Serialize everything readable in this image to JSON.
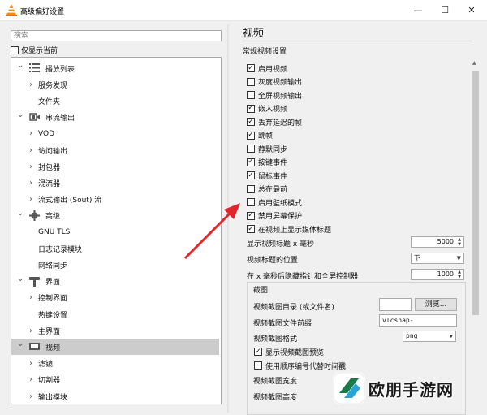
{
  "window": {
    "title": "高级偏好设置",
    "controls": {
      "minimize": "—",
      "maximize": "☐",
      "close": "✕"
    }
  },
  "left": {
    "search_placeholder": "搜索",
    "only_current_label": "仅显示当前",
    "tree": [
      {
        "level": 0,
        "label": "播放列表",
        "expanded": true,
        "icon": "playlist-icon"
      },
      {
        "level": 1,
        "label": "服务发现",
        "has_children": true
      },
      {
        "level": 1,
        "label": "文件夹",
        "has_children": false
      },
      {
        "level": 0,
        "label": "串流输出",
        "expanded": true,
        "icon": "stream-output-icon"
      },
      {
        "level": 1,
        "label": "VOD",
        "has_children": true
      },
      {
        "level": 1,
        "label": "访问输出",
        "has_children": true
      },
      {
        "level": 1,
        "label": "封包器",
        "has_children": true
      },
      {
        "level": 1,
        "label": "混流器",
        "has_children": true
      },
      {
        "level": 1,
        "label": "流式输出 (Sout) 流",
        "has_children": true
      },
      {
        "level": 0,
        "label": "高级",
        "expanded": true,
        "icon": "gear-icon"
      },
      {
        "level": 1,
        "label": "GNU TLS",
        "has_children": false
      },
      {
        "level": 1,
        "label": "日志记录模块",
        "has_children": false
      },
      {
        "level": 1,
        "label": "网络同步",
        "has_children": false
      },
      {
        "level": 0,
        "label": "界面",
        "expanded": true,
        "icon": "interface-icon"
      },
      {
        "level": 1,
        "label": "控制界面",
        "has_children": true
      },
      {
        "level": 1,
        "label": "热键设置",
        "has_children": false
      },
      {
        "level": 1,
        "label": "主界面",
        "has_children": true
      },
      {
        "level": 0,
        "label": "视频",
        "expanded": true,
        "icon": "video-icon",
        "selected": true
      },
      {
        "level": 1,
        "label": "滤镜",
        "has_children": true
      },
      {
        "level": 1,
        "label": "切割器",
        "has_children": true
      },
      {
        "level": 1,
        "label": "输出模块",
        "has_children": true
      }
    ]
  },
  "right": {
    "section_title": "视频",
    "group_title": "常规视频设置",
    "checkboxes": [
      {
        "label": "启用视频",
        "checked": true
      },
      {
        "label": "灰度视频输出",
        "checked": false
      },
      {
        "label": "全屏视频输出",
        "checked": false
      },
      {
        "label": "嵌入视频",
        "checked": true
      },
      {
        "label": "丢弃延迟的帧",
        "checked": true
      },
      {
        "label": "跳帧",
        "checked": true
      },
      {
        "label": "静默同步",
        "checked": false
      },
      {
        "label": "按键事件",
        "checked": true
      },
      {
        "label": "鼠标事件",
        "checked": true
      },
      {
        "label": "总在最前",
        "checked": false
      },
      {
        "label": "启用壁纸模式",
        "checked": false
      },
      {
        "label": "禁用屏幕保护",
        "checked": true
      },
      {
        "label": "在视频上显示媒体标题",
        "checked": true
      }
    ],
    "title_timeout": {
      "label": "显示视频标题 x 毫秒",
      "value": "5000"
    },
    "title_position": {
      "label": "视频标题的位置",
      "value": "下"
    },
    "hide_cursor": {
      "label": "在 x 毫秒后隐藏指针和全屏控制器",
      "value": "1000"
    },
    "snapshot": {
      "group_title": "截图",
      "dir_label": "视频截图目录 (或文件名)",
      "dir_value": "",
      "browse_label": "浏览...",
      "prefix_label": "视频截图文件前缀",
      "prefix_value": "vlcsnap-",
      "format_label": "视频截图格式",
      "format_value": "png",
      "preview_label": "显示视频截图预览",
      "preview_checked": true,
      "sequential_label": "使用顺序编号代替时间戳",
      "sequential_checked": false,
      "width_label": "视频截图宽度",
      "height_label": "视频截图高度"
    }
  },
  "watermark": {
    "text": "欧朋手游网"
  },
  "colors": {
    "selection": "#cccccc",
    "arrow": "#e0252b",
    "vlc_orange": "#ff8800"
  }
}
